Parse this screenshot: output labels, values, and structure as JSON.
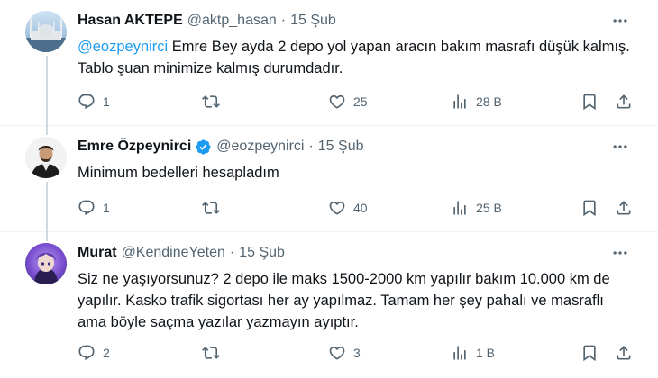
{
  "tweets": [
    {
      "name": "Hasan AKTEPE",
      "handle": "@aktp_hasan",
      "dot": "·",
      "date": "15 Şub",
      "mention": "@eozpeynirci",
      "text": " Emre Bey ayda 2 depo yol yapan aracın bakım masrafı düşük kalmış. Tablo şuan minimize kalmış durumdadır.",
      "replies": "1",
      "retweets": "",
      "likes": "25",
      "views": "28 B"
    },
    {
      "name": "Emre Özpeynirci",
      "verified": true,
      "handle": "@eozpeynirci",
      "dot": "·",
      "date": "15 Şub",
      "text": "Minimum bedelleri hesapladım",
      "replies": "1",
      "retweets": "",
      "likes": "40",
      "views": "25 B"
    },
    {
      "name": "Murat",
      "handle": "@KendineYeten",
      "dot": "·",
      "date": "15 Şub",
      "text": "Siz ne yaşıyorsunuz? 2 depo ile maks 1500-2000 km yapılır bakım 10.000 km de yapılır. Kasko trafik sigortası her ay yapılmaz. Tamam her şey pahalı ve masraflı ama böyle saçma yazılar yazmayın ayıptır.",
      "replies": "2",
      "retweets": "",
      "likes": "3",
      "views": "1 B"
    }
  ],
  "colors": {
    "text": "#0f1419",
    "secondary": "#536471",
    "mention": "#1d9bf0",
    "verified": "#1d9bf0",
    "thread_line": "#cfd9de",
    "divider": "#eff3f4"
  },
  "icons": [
    "reply-icon",
    "retweet-icon",
    "like-icon",
    "views-icon",
    "bookmark-icon",
    "share-icon",
    "more-icon",
    "verified-icon"
  ]
}
